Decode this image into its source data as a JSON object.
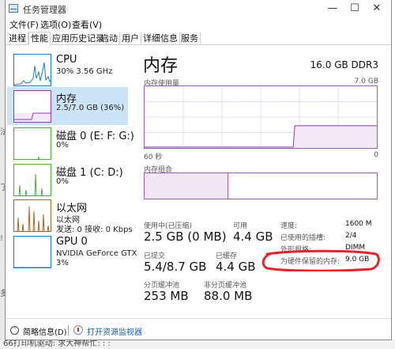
{
  "window": {
    "title": "任务管理器",
    "minimize_glyph": "—",
    "maximize_glyph": "☐",
    "close_glyph": "✕"
  },
  "menu": [
    "文件(F)",
    "选项(O)",
    "查看(V)"
  ],
  "tabs": [
    "进程",
    "性能",
    "应用历史记录",
    "启动",
    "用户",
    "详细信息",
    "服务"
  ],
  "active_tab": "性能",
  "sidebar": {
    "items": [
      {
        "name": "CPU",
        "line1": "30%  3.56 GHz",
        "line2": "",
        "color": "#1a7ec4",
        "icon": "cpu-graph-thumbnail"
      },
      {
        "name": "内存",
        "line1": "2.5/7.0 GB (36%)",
        "line2": "",
        "color": "#8b3fa6",
        "icon": "memory-graph-thumbnail",
        "selected": true
      },
      {
        "name": "磁盘 0 (E: F: G:)",
        "line1": "0%",
        "line2": "",
        "color": "#4caf32",
        "icon": "disk0-graph-thumbnail"
      },
      {
        "name": "磁盘 1 (C: D:)",
        "line1": "0%",
        "line2": "",
        "color": "#4caf32",
        "icon": "disk1-graph-thumbnail"
      },
      {
        "name": "以太网",
        "line1": "以太网",
        "line2": "发送: 0 接收: 0 Kbps",
        "color": "#a0672b",
        "icon": "ethernet-graph-thumbnail"
      },
      {
        "name": "GPU 0",
        "line1": "NVIDIA GeForce GTX",
        "line2": "3%",
        "color": "#1a7ec4",
        "icon": "gpu-graph-thumbnail"
      }
    ]
  },
  "main": {
    "title": "内存",
    "spec": "16.0 GB DDR3",
    "usage_label": "内存使用量",
    "usage_max": "7.0 GB",
    "axis_left": "60 秒",
    "axis_right": "0",
    "composition_label": "内存组合",
    "composition_used_fraction": 0.36,
    "usage_level_fraction": 0.36,
    "stats": {
      "in_use_label": "使用中(已压缩)",
      "in_use_value": "2.5 GB (0 MB)",
      "available_label": "可用",
      "available_value": "4.4 GB",
      "committed_label": "已提交",
      "committed_value": "5.4/8.7 GB",
      "cached_label": "已缓存",
      "cached_value": "4.4 GB",
      "paged_label": "分页缓冲池",
      "paged_value": "253 MB",
      "nonpaged_label": "非分页缓冲池",
      "nonpaged_value": "88.0 MB"
    },
    "specs": [
      {
        "key": "速度:",
        "value": "1600 M"
      },
      {
        "key": "已使用的插槽:",
        "value": "2/4"
      },
      {
        "key": "外形规格:",
        "value": "DIMM"
      },
      {
        "key": "为硬件保留的内存:",
        "value": "9.0 GB"
      }
    ],
    "highlight_color": "#e3242b"
  },
  "footer": {
    "fewer_details": "简略信息(D)",
    "resource_monitor": "打开资源监视器"
  },
  "background": {
    "bottom_text": "66打印机驱动:   求大神帮忙:  :  :"
  }
}
